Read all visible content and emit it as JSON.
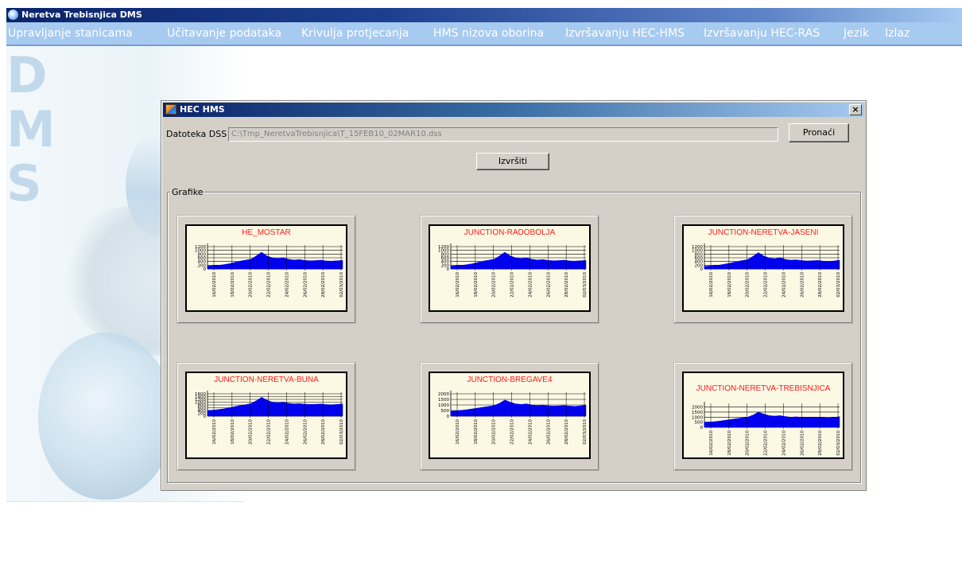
{
  "app": {
    "title": "Neretva Trebisnjica DMS"
  },
  "menu": [
    {
      "label": "Upravljanje stanicama"
    },
    {
      "label": "Učitavanje podataka"
    },
    {
      "label": "Krivulja protjecanja"
    },
    {
      "label": "HMS nizova oborina"
    },
    {
      "label": "Izvršavanju HEC-HMS"
    },
    {
      "label": "Izvršavanju HEC-RAS"
    },
    {
      "label": "Jezik"
    },
    {
      "label": "Izlaz"
    }
  ],
  "background": {
    "letters": [
      "D",
      "M",
      "S"
    ]
  },
  "dialog": {
    "title": "HEC HMS",
    "close_glyph": "×",
    "dss_label": "Datoteka DSS",
    "dss_value": "C:\\Tmp_NeretvaTrebisnjica\\T_15FEB10_02MAR10.dss",
    "find_button": "Pronaći",
    "run_button": "Izvršiti",
    "group_label": "Grafike"
  },
  "colors": {
    "series_fill": "#0000ee",
    "title_red": "#ff1a1a",
    "chart_background": "#fbf8e4"
  },
  "chart_data": [
    {
      "type": "area",
      "title": "HE_MOSTAR",
      "x": [
        "16/02/2010",
        "18/02/2010",
        "20/02/2010",
        "22/02/2010",
        "24/02/2010",
        "26/02/2010",
        "28/02/2010",
        "02/03/2010"
      ],
      "y_ticks": [
        "1200",
        "1000",
        "800",
        "600",
        "400",
        "200",
        "0"
      ],
      "ylim": [
        0,
        1200
      ],
      "values": [
        150,
        170,
        190,
        230,
        280,
        350,
        420,
        470,
        520,
        700,
        900,
        700,
        600,
        560,
        600,
        520,
        480,
        500,
        460,
        440,
        450,
        470,
        430,
        420,
        440,
        460
      ]
    },
    {
      "type": "area",
      "title": "JUNCTION-RADOBOLJA",
      "x": [
        "16/02/2010",
        "18/02/2010",
        "20/02/2010",
        "22/02/2010",
        "24/02/2010",
        "26/02/2010",
        "28/02/2010",
        "02/03/2010"
      ],
      "y_ticks": [
        "1200",
        "1000",
        "800",
        "600",
        "400",
        "200",
        "0"
      ],
      "ylim": [
        0,
        1200
      ],
      "values": [
        150,
        170,
        190,
        230,
        280,
        350,
        420,
        470,
        520,
        700,
        900,
        700,
        600,
        560,
        600,
        520,
        480,
        500,
        460,
        440,
        450,
        470,
        430,
        420,
        440,
        460
      ]
    },
    {
      "type": "area",
      "title": "JUNCTION-NERETVA-JASENI",
      "x": [
        "16/02/2010",
        "18/02/2010",
        "20/02/2010",
        "22/02/2010",
        "24/02/2010",
        "26/02/2010",
        "28/02/2010",
        "02/03/2010"
      ],
      "y_ticks": [
        "1200",
        "1000",
        "800",
        "600",
        "400",
        "200",
        "0"
      ],
      "ylim": [
        0,
        1200
      ],
      "values": [
        140,
        160,
        180,
        220,
        270,
        330,
        400,
        450,
        500,
        680,
        880,
        690,
        590,
        550,
        610,
        510,
        470,
        490,
        450,
        430,
        440,
        460,
        420,
        410,
        430,
        470
      ]
    },
    {
      "type": "area",
      "title": "JUNCTION-NERETVA-BUNA",
      "x": [
        "16/02/2010",
        "18/02/2010",
        "20/02/2010",
        "22/02/2010",
        "24/02/2010",
        "26/02/2010",
        "28/02/2010",
        "02/03/2010"
      ],
      "y_ticks": [
        "1600",
        "1400",
        "1200",
        "1000",
        "800",
        "600",
        "400",
        "200",
        "0"
      ],
      "ylim": [
        0,
        1600
      ],
      "values": [
        400,
        430,
        470,
        520,
        600,
        680,
        760,
        820,
        900,
        1100,
        1350,
        1150,
        1000,
        960,
        1000,
        920,
        880,
        900,
        860,
        840,
        850,
        870,
        830,
        820,
        840,
        880
      ]
    },
    {
      "type": "area",
      "title": "JUNCTION-BREGAVE4",
      "x": [
        "16/02/2010",
        "18/02/2010",
        "20/02/2010",
        "22/02/2010",
        "24/02/2010",
        "26/02/2010",
        "28/02/2010",
        "02/03/2010"
      ],
      "y_ticks": [
        "2000",
        "1500",
        "1000",
        "500",
        "0"
      ],
      "ylim": [
        0,
        2000
      ],
      "values": [
        450,
        480,
        520,
        580,
        650,
        720,
        800,
        870,
        950,
        1150,
        1450,
        1250,
        1100,
        1050,
        1100,
        1000,
        950,
        980,
        930,
        900,
        920,
        950,
        900,
        880,
        920,
        1000
      ]
    },
    {
      "type": "area",
      "title": "JUNCTION-NERETVA-TREBISNJICA",
      "x": [
        "16/02/2010",
        "18/02/2010",
        "20/02/2010",
        "22/02/2010",
        "24/02/2010",
        "26/02/2010",
        "28/02/2010",
        "02/03/2010"
      ],
      "y_ticks": [
        "2000",
        "1500",
        "1000",
        "500",
        "0"
      ],
      "ylim": [
        0,
        2200
      ],
      "values": [
        500,
        520,
        560,
        620,
        700,
        780,
        860,
        930,
        1000,
        1200,
        1500,
        1300,
        1150,
        1100,
        1150,
        1050,
        1000,
        1030,
        980,
        950,
        970,
        1000,
        950,
        930,
        970,
        1050
      ]
    }
  ]
}
